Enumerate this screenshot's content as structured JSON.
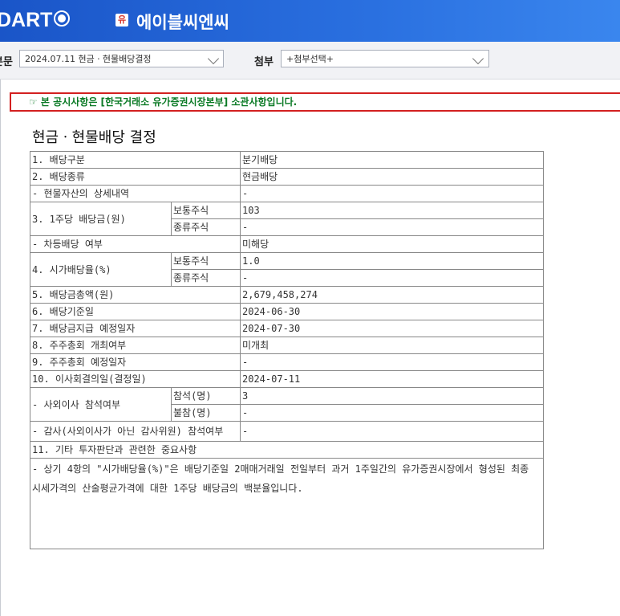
{
  "header": {
    "logo_text": "DART",
    "company_badge": "유",
    "company_name": "에이블씨엔씨"
  },
  "selector": {
    "doc_label": "본문",
    "doc_value": "2024.07.11  현금ㆍ현물배당결정",
    "attach_label": "첨부",
    "attach_value": "+첨부선택+"
  },
  "notice": "☞ 본 공시사항은 [한국거래소 유가증권시장본부] 소관사항입니다.",
  "doc_title": "현금ㆍ현물배당 결정",
  "table": {
    "r1": [
      "1. 배당구분",
      "분기배당"
    ],
    "r2": [
      "2. 배당종류",
      "현금배당"
    ],
    "r3": [
      "- 현물자산의 상세내역",
      "-"
    ],
    "r4": {
      "label": "3. 1주당 배당금(원)",
      "sub1": "보통주식",
      "val1": "103",
      "sub2": "종류주식",
      "val2": "-"
    },
    "r5": [
      "- 차등배당 여부",
      "미해당"
    ],
    "r6": {
      "label": "4. 시가배당율(%)",
      "sub1": "보통주식",
      "val1": "1.0",
      "sub2": "종류주식",
      "val2": "-"
    },
    "r7": [
      "5. 배당금총액(원)",
      "2,679,458,274"
    ],
    "r8": [
      "6. 배당기준일",
      "2024-06-30"
    ],
    "r9": [
      "7. 배당금지급 예정일자",
      "2024-07-30"
    ],
    "r10": [
      "8. 주주총회 개최여부",
      "미개최"
    ],
    "r11": [
      "9. 주주총회 예정일자",
      "-"
    ],
    "r12": [
      "10. 이사회결의일(결정일)",
      "2024-07-11"
    ],
    "r13": {
      "label": "- 사외이사 참석여부",
      "sub1": "참석(명)",
      "val1": "3",
      "sub2": "불참(명)",
      "val2": "-"
    },
    "r14": [
      "- 감사(사외이사가 아닌 감사위원) 참석여부",
      "-"
    ],
    "r15": "11. 기타 투자판단과 관련한 중요사항",
    "r16": "- 상기 4항의 \"시가배당율(%)\"은 배당기준일 2매매거래일 전일부터 과거 1주일간의 유가증권시장에서 형성된 최종 시세가격의 산술평균가격에 대한 1주당 배당금의 백분율입니다."
  }
}
